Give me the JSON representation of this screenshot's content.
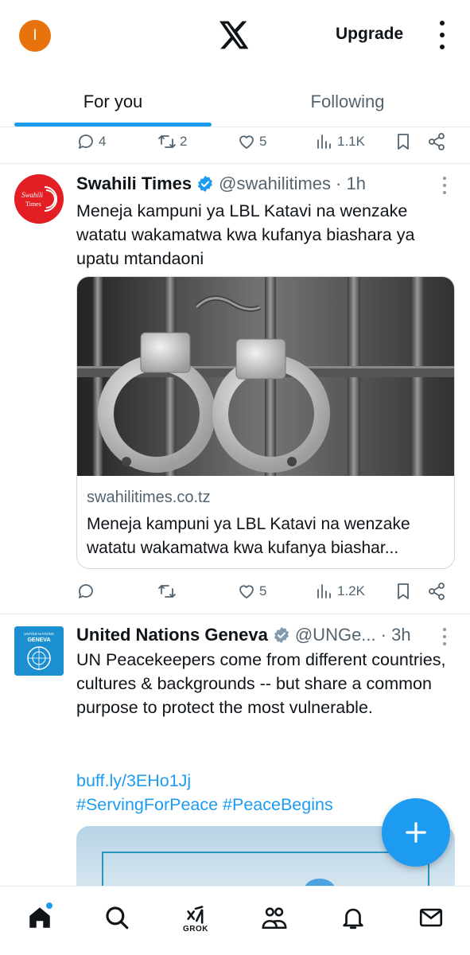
{
  "header": {
    "avatar_initial": "I",
    "avatar_color": "#e8720c",
    "logo_icon": "x-logo-icon",
    "upgrade_label": "Upgrade",
    "menu_icon": "more-vertical-icon"
  },
  "tabs": [
    {
      "label": "For you",
      "active": true
    },
    {
      "label": "Following",
      "active": false
    }
  ],
  "accent_color": "#1d9bf0",
  "feed": [
    {
      "partial": true,
      "actions": {
        "replies": "4",
        "reposts": "2",
        "likes": "5",
        "views": "1.1K"
      }
    },
    {
      "author": "Swahili Times",
      "verified": true,
      "handle": "@swahilitimes",
      "time": "· 1h",
      "avatar_text": "Swahili Times",
      "text": "Meneja kampuni ya LBL Katavi na wenzake watatu wakamatwa kwa kufanya biashara ya upatu mtandaoni",
      "card": {
        "image_desc": "handcuffs-image",
        "domain": "swahilitimes.co.tz",
        "title": "Meneja kampuni ya LBL Katavi na wenzake watatu wakamatwa kwa kufanya biashar..."
      },
      "actions": {
        "replies": "",
        "reposts": "",
        "likes": "5",
        "views": "1.2K"
      }
    },
    {
      "author": "United Nations Geneva",
      "verified": true,
      "handle": "@UNGe...",
      "time": "· 3h",
      "avatar_text": "UNITED NATIONS GENEVA",
      "text": "UN Peacekeepers come from different countries, cultures & backgrounds -- but share a common purpose to protect the most vulnerable.",
      "link": "buff.ly/3EHo1Jj",
      "hashtags": "#ServingForPeace #PeaceBegins"
    }
  ],
  "compose_button_icon": "plus-icon",
  "bottom_nav": [
    {
      "name": "home",
      "icon": "home-icon",
      "active": true,
      "notification": true
    },
    {
      "name": "search",
      "icon": "search-icon"
    },
    {
      "name": "grok",
      "icon": "grok-icon",
      "label": "GROK"
    },
    {
      "name": "communities",
      "icon": "people-icon"
    },
    {
      "name": "notifications",
      "icon": "bell-icon"
    },
    {
      "name": "messages",
      "icon": "mail-icon"
    }
  ]
}
